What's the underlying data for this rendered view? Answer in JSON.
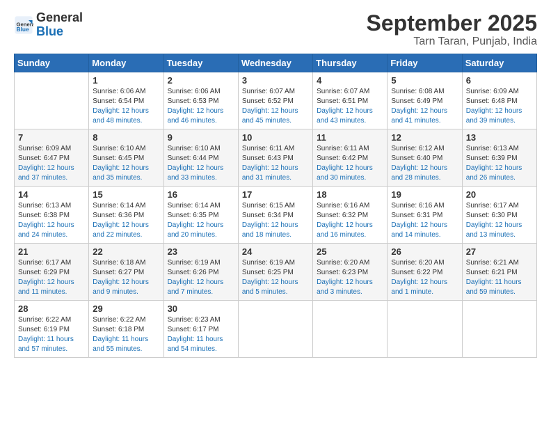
{
  "logo": {
    "general": "General",
    "blue": "Blue"
  },
  "title": "September 2025",
  "subtitle": "Tarn Taran, Punjab, India",
  "days_of_week": [
    "Sunday",
    "Monday",
    "Tuesday",
    "Wednesday",
    "Thursday",
    "Friday",
    "Saturday"
  ],
  "weeks": [
    [
      {
        "date": "",
        "sunrise": "",
        "sunset": "",
        "daylight": ""
      },
      {
        "date": "1",
        "sunrise": "6:06 AM",
        "sunset": "6:54 PM",
        "daylight": "12 hours and 48 minutes."
      },
      {
        "date": "2",
        "sunrise": "6:06 AM",
        "sunset": "6:53 PM",
        "daylight": "12 hours and 46 minutes."
      },
      {
        "date": "3",
        "sunrise": "6:07 AM",
        "sunset": "6:52 PM",
        "daylight": "12 hours and 45 minutes."
      },
      {
        "date": "4",
        "sunrise": "6:07 AM",
        "sunset": "6:51 PM",
        "daylight": "12 hours and 43 minutes."
      },
      {
        "date": "5",
        "sunrise": "6:08 AM",
        "sunset": "6:49 PM",
        "daylight": "12 hours and 41 minutes."
      },
      {
        "date": "6",
        "sunrise": "6:09 AM",
        "sunset": "6:48 PM",
        "daylight": "12 hours and 39 minutes."
      }
    ],
    [
      {
        "date": "7",
        "sunrise": "6:09 AM",
        "sunset": "6:47 PM",
        "daylight": "12 hours and 37 minutes."
      },
      {
        "date": "8",
        "sunrise": "6:10 AM",
        "sunset": "6:45 PM",
        "daylight": "12 hours and 35 minutes."
      },
      {
        "date": "9",
        "sunrise": "6:10 AM",
        "sunset": "6:44 PM",
        "daylight": "12 hours and 33 minutes."
      },
      {
        "date": "10",
        "sunrise": "6:11 AM",
        "sunset": "6:43 PM",
        "daylight": "12 hours and 31 minutes."
      },
      {
        "date": "11",
        "sunrise": "6:11 AM",
        "sunset": "6:42 PM",
        "daylight": "12 hours and 30 minutes."
      },
      {
        "date": "12",
        "sunrise": "6:12 AM",
        "sunset": "6:40 PM",
        "daylight": "12 hours and 28 minutes."
      },
      {
        "date": "13",
        "sunrise": "6:13 AM",
        "sunset": "6:39 PM",
        "daylight": "12 hours and 26 minutes."
      }
    ],
    [
      {
        "date": "14",
        "sunrise": "6:13 AM",
        "sunset": "6:38 PM",
        "daylight": "12 hours and 24 minutes."
      },
      {
        "date": "15",
        "sunrise": "6:14 AM",
        "sunset": "6:36 PM",
        "daylight": "12 hours and 22 minutes."
      },
      {
        "date": "16",
        "sunrise": "6:14 AM",
        "sunset": "6:35 PM",
        "daylight": "12 hours and 20 minutes."
      },
      {
        "date": "17",
        "sunrise": "6:15 AM",
        "sunset": "6:34 PM",
        "daylight": "12 hours and 18 minutes."
      },
      {
        "date": "18",
        "sunrise": "6:16 AM",
        "sunset": "6:32 PM",
        "daylight": "12 hours and 16 minutes."
      },
      {
        "date": "19",
        "sunrise": "6:16 AM",
        "sunset": "6:31 PM",
        "daylight": "12 hours and 14 minutes."
      },
      {
        "date": "20",
        "sunrise": "6:17 AM",
        "sunset": "6:30 PM",
        "daylight": "12 hours and 13 minutes."
      }
    ],
    [
      {
        "date": "21",
        "sunrise": "6:17 AM",
        "sunset": "6:29 PM",
        "daylight": "12 hours and 11 minutes."
      },
      {
        "date": "22",
        "sunrise": "6:18 AM",
        "sunset": "6:27 PM",
        "daylight": "12 hours and 9 minutes."
      },
      {
        "date": "23",
        "sunrise": "6:19 AM",
        "sunset": "6:26 PM",
        "daylight": "12 hours and 7 minutes."
      },
      {
        "date": "24",
        "sunrise": "6:19 AM",
        "sunset": "6:25 PM",
        "daylight": "12 hours and 5 minutes."
      },
      {
        "date": "25",
        "sunrise": "6:20 AM",
        "sunset": "6:23 PM",
        "daylight": "12 hours and 3 minutes."
      },
      {
        "date": "26",
        "sunrise": "6:20 AM",
        "sunset": "6:22 PM",
        "daylight": "12 hours and 1 minute."
      },
      {
        "date": "27",
        "sunrise": "6:21 AM",
        "sunset": "6:21 PM",
        "daylight": "11 hours and 59 minutes."
      }
    ],
    [
      {
        "date": "28",
        "sunrise": "6:22 AM",
        "sunset": "6:19 PM",
        "daylight": "11 hours and 57 minutes."
      },
      {
        "date": "29",
        "sunrise": "6:22 AM",
        "sunset": "6:18 PM",
        "daylight": "11 hours and 55 minutes."
      },
      {
        "date": "30",
        "sunrise": "6:23 AM",
        "sunset": "6:17 PM",
        "daylight": "11 hours and 54 minutes."
      },
      {
        "date": "",
        "sunrise": "",
        "sunset": "",
        "daylight": ""
      },
      {
        "date": "",
        "sunrise": "",
        "sunset": "",
        "daylight": ""
      },
      {
        "date": "",
        "sunrise": "",
        "sunset": "",
        "daylight": ""
      },
      {
        "date": "",
        "sunrise": "",
        "sunset": "",
        "daylight": ""
      }
    ]
  ]
}
